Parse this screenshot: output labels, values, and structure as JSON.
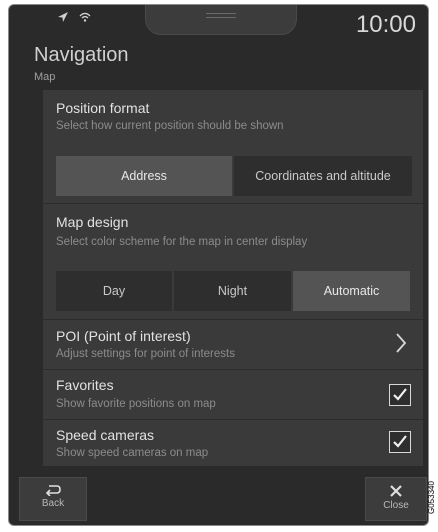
{
  "status": {
    "time": "10:00"
  },
  "header": {
    "title": "Navigation",
    "subtitle": "Map"
  },
  "settings": {
    "position_format": {
      "title": "Position format",
      "subtitle": "Select how current position should be shown",
      "options": [
        "Address",
        "Coordinates and altitude"
      ],
      "selected": "Address"
    },
    "map_design": {
      "title": "Map design",
      "subtitle": "Select color scheme for the map in center display",
      "options": [
        "Day",
        "Night",
        "Automatic"
      ],
      "selected": "Automatic"
    },
    "poi": {
      "title": "POI (Point of interest)",
      "subtitle": "Adjust settings for point of interests"
    },
    "favorites": {
      "title": "Favorites",
      "subtitle": "Show favorite positions on map",
      "checked": true
    },
    "speed_cameras": {
      "title": "Speed cameras",
      "subtitle": "Show speed cameras on map",
      "checked": true
    }
  },
  "footer": {
    "back_label": "Back",
    "close_label": "Close"
  },
  "stamp": "G053340",
  "icons": {
    "location": "location-arrow-icon",
    "wifi": "wifi-icon",
    "chevron": "chevron-right-icon",
    "check": "checkmark-icon",
    "back": "back-arrow-icon",
    "close": "close-icon"
  }
}
